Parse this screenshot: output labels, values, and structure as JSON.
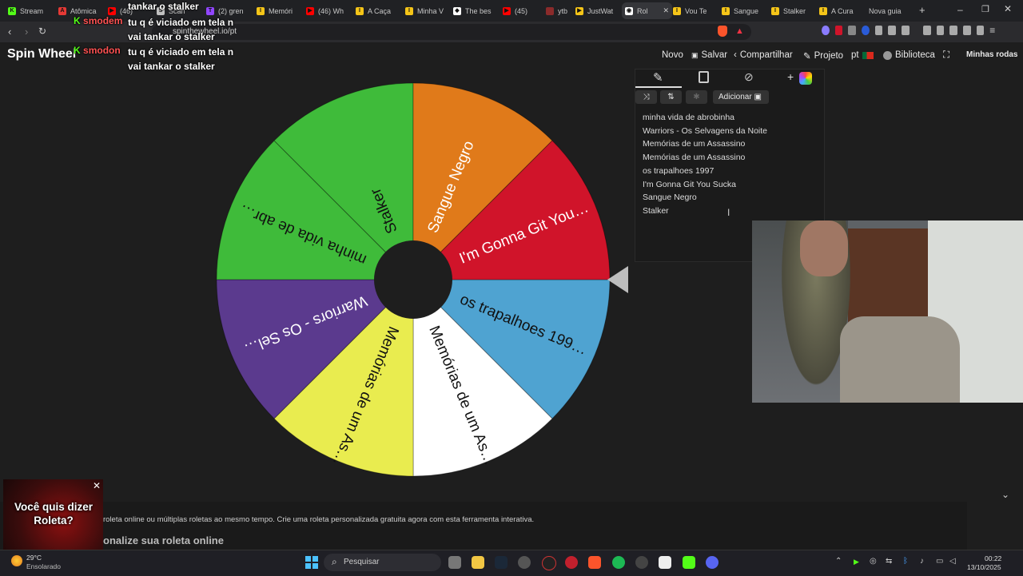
{
  "browser": {
    "tabs": [
      {
        "label": "Stream",
        "color": "#53fc18",
        "glyph": "K"
      },
      {
        "label": "Atômica",
        "color": "#e53935",
        "glyph": "A"
      },
      {
        "label": "(46)",
        "color": "#ff0000",
        "glyph": "▶"
      },
      {
        "label": "Scan",
        "color": "#c0c0c0",
        "glyph": "S"
      },
      {
        "label": "(2) gren",
        "color": "#9146ff",
        "glyph": "T"
      },
      {
        "label": "Memóri",
        "color": "#f5c518",
        "glyph": "I"
      },
      {
        "label": "(46) Wh",
        "color": "#ff0000",
        "glyph": "▶"
      },
      {
        "label": "A Caça",
        "color": "#f5c518",
        "glyph": "I"
      },
      {
        "label": "Minha V",
        "color": "#f5c518",
        "glyph": "I"
      },
      {
        "label": "The bes",
        "color": "#ffffff",
        "glyph": "◆"
      },
      {
        "label": "(45)",
        "color": "#ff0000",
        "glyph": "▶"
      },
      {
        "label": "ytb",
        "color": "#8b2b2b",
        "glyph": ""
      },
      {
        "label": "JustWat",
        "color": "#f5c518",
        "glyph": "▶"
      },
      {
        "label": "Rol",
        "color": "#ffffff",
        "glyph": "◉"
      },
      {
        "label": "Vou Te",
        "color": "#f5c518",
        "glyph": "I"
      },
      {
        "label": "Sangue",
        "color": "#f5c518",
        "glyph": "I"
      },
      {
        "label": "Stalker",
        "color": "#f5c518",
        "glyph": "I"
      },
      {
        "label": "A Cura",
        "color": "#f5c518",
        "glyph": "I"
      },
      {
        "label": "Nova guia",
        "color": "",
        "glyph": ""
      }
    ],
    "url": "spinthewheel.io/pt"
  },
  "site": {
    "logo": "Spin Wheel",
    "nav": {
      "novo": "Novo",
      "salvar": "Salvar",
      "compartilhar": "Compartilhar",
      "projeto": "Projeto",
      "lang": "pt",
      "biblioteca": "Biblioteca",
      "minhas_rodas": "Minhas rodas"
    },
    "adicionar": "Adicionar",
    "entries": [
      "minha vida de abrobinha",
      "Warriors - Os Selvagens da Noite",
      "Memórias de um Assassino",
      "Memórias de um Assassino",
      "os trapalhoes 1997",
      "I'm Gonna Git You Sucka",
      "Sangue Negro",
      "Stalker"
    ]
  },
  "wheel": {
    "slices": [
      {
        "label": "os trapalhoes 199…",
        "color": "#4fa3d1",
        "text_color": "#111111"
      },
      {
        "label": "Memórias de um As…",
        "color": "#ffffff",
        "text_color": "#111111"
      },
      {
        "label": "Memórias de um As…",
        "color": "#e9ec4f",
        "text_color": "#111111"
      },
      {
        "label": "Warriors - Os Sel…",
        "color": "#5b3a8e",
        "text_color": "#ffffff"
      },
      {
        "label": "minha vida de abr…",
        "color": "#3fbb3a",
        "text_color": "#111111"
      },
      {
        "label": "Stalker",
        "color": "#3fbb3a",
        "text_color": "#111111"
      },
      {
        "label": "Sangue Negro",
        "color": "#e07a1a",
        "text_color": "#ffffff"
      },
      {
        "label": "I'm Gonna Git You…",
        "color": "#d0142a",
        "text_color": "#ffffff"
      }
    ]
  },
  "chat": [
    {
      "nick": "",
      "text": "tankar o stalker"
    },
    {
      "nick": "smodem",
      "text": "tu q é viciado em tela n vai tankar o stalker"
    },
    {
      "nick": "smodon",
      "text": "tu q é viciado em tela n vai tankar o stalker"
    }
  ],
  "promo": {
    "text": "Você quis dizer Roleta?"
  },
  "bottom": {
    "description": "roleta online ou múltiplas roletas ao mesmo tempo. Crie uma roleta personalizada gratuita agora com esta ferramenta interativa.",
    "heading": "onalize sua roleta online"
  },
  "taskbar": {
    "weather_temp": "29°C",
    "weather_desc": "Ensolarado",
    "search": "Pesquisar",
    "time": "00:22",
    "date": "13/10/2025"
  }
}
